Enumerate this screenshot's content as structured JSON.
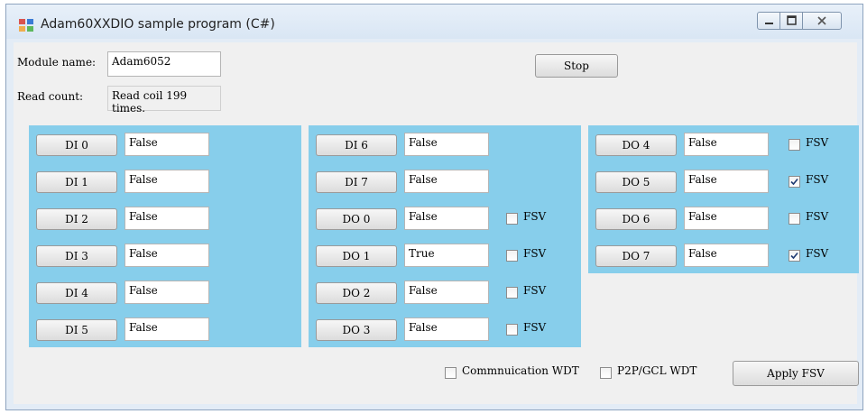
{
  "window": {
    "title": "Adam60XXDIO sample program (C#)",
    "controls": [
      "minimize",
      "maximize",
      "close"
    ]
  },
  "module_label": "Module name:",
  "module_name": "Adam6052",
  "read_label": "Read count:",
  "read_count": "Read coil 199 times.",
  "stop_label": "Stop",
  "panel1": [
    {
      "label": "DI 0",
      "value": "False"
    },
    {
      "label": "DI 1",
      "value": "False"
    },
    {
      "label": "DI 2",
      "value": "False"
    },
    {
      "label": "DI 3",
      "value": "False"
    },
    {
      "label": "DI 4",
      "value": "False"
    },
    {
      "label": "DI 5",
      "value": "False"
    }
  ],
  "panel2": [
    {
      "label": "DI 6",
      "value": "False",
      "fsv": null
    },
    {
      "label": "DI 7",
      "value": "False",
      "fsv": null
    },
    {
      "label": "DO 0",
      "value": "False",
      "fsv": false
    },
    {
      "label": "DO 1",
      "value": "True",
      "fsv": false
    },
    {
      "label": "DO 2",
      "value": "False",
      "fsv": false
    },
    {
      "label": "DO 3",
      "value": "False",
      "fsv": false
    }
  ],
  "panel3": [
    {
      "label": "DO 4",
      "value": "False",
      "fsv": false
    },
    {
      "label": "DO 5",
      "value": "False",
      "fsv": true
    },
    {
      "label": "DO 6",
      "value": "False",
      "fsv": false
    },
    {
      "label": "DO 7",
      "value": "False",
      "fsv": true
    }
  ],
  "fsv_label": "FSV",
  "comm_wdt_label": "Commnuication WDT",
  "comm_wdt_checked": false,
  "p2p_wdt_label": "P2P/GCL WDT",
  "p2p_wdt_checked": false,
  "apply_label": "Apply FSV",
  "colors": {
    "panel": "#87ceeb",
    "window_frame": "#e3ecf6"
  }
}
